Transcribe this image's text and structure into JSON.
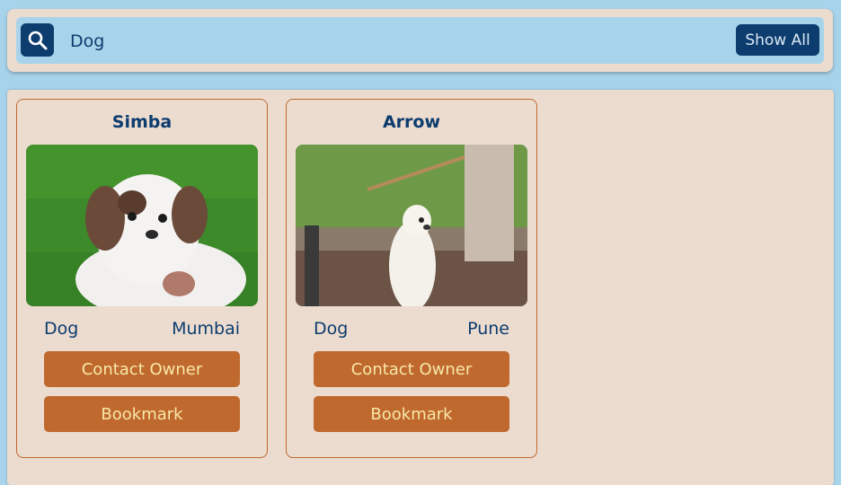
{
  "search": {
    "value": "Dog",
    "show_all_label": "Show All",
    "icon": "search-icon"
  },
  "pets": [
    {
      "name": "Simba",
      "type": "Dog",
      "city": "Mumbai",
      "contact_label": "Contact Owner",
      "bookmark_label": "Bookmark"
    },
    {
      "name": "Arrow",
      "type": "Dog",
      "city": "Pune",
      "contact_label": "Contact Owner",
      "bookmark_label": "Bookmark"
    }
  ],
  "colors": {
    "navy": "#0d3c6e",
    "sky": "#a8d4eb",
    "beige": "#ecdcd0",
    "orange": "#c0692e",
    "button_text": "#f7e8a8"
  }
}
